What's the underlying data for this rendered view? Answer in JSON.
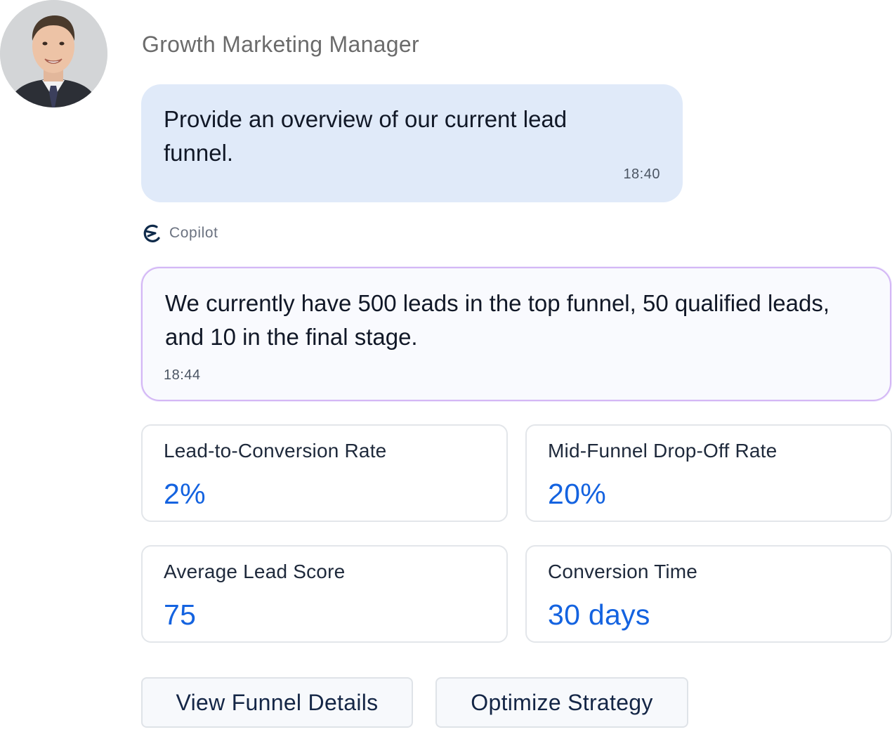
{
  "header": {
    "role_title": "Growth Marketing Manager"
  },
  "messages": [
    {
      "sender": "user",
      "text": "Provide an overview of our current lead funnel.",
      "time": "18:40"
    },
    {
      "sender": "assistant",
      "text": "We currently have 500 leads in the top funnel, 50 qualified leads, and 10 in the final stage.",
      "time": "18:44"
    }
  ],
  "assistant": {
    "name": "Copilot",
    "icon": "copilot-logo-icon"
  },
  "metrics": [
    {
      "label": "Lead-to-Conversion Rate",
      "value": "2%"
    },
    {
      "label": "Mid-Funnel Drop-Off Rate",
      "value": "20%"
    },
    {
      "label": "Average Lead Score",
      "value": "75"
    },
    {
      "label": "Conversion Time",
      "value": "30 days"
    }
  ],
  "actions": {
    "view_funnel_details": "View Funnel Details",
    "optimize_strategy": "Optimize Strategy"
  },
  "colors": {
    "user_bubble": "#e0eaf9",
    "assistant_border": "#d4b7f5",
    "metric_value": "#1463e0"
  }
}
